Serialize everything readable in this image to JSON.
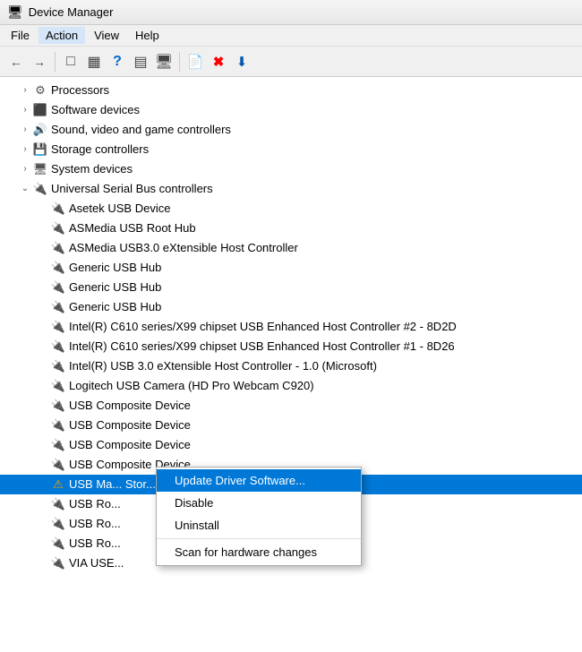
{
  "window": {
    "title": "Device Manager",
    "titleIcon": "🖥"
  },
  "menuBar": {
    "items": [
      {
        "label": "File",
        "id": "file"
      },
      {
        "label": "Action",
        "id": "action",
        "active": true
      },
      {
        "label": "View",
        "id": "view"
      },
      {
        "label": "Help",
        "id": "help"
      }
    ]
  },
  "toolbar": {
    "buttons": [
      {
        "id": "back",
        "icon": "←",
        "disabled": false
      },
      {
        "id": "forward",
        "icon": "→",
        "disabled": false
      },
      {
        "id": "up",
        "icon": "⬆",
        "disabled": false
      },
      {
        "id": "show-hidden",
        "icon": "▦",
        "disabled": false
      },
      {
        "id": "refresh",
        "icon": "↻",
        "disabled": false
      },
      {
        "separator": true
      },
      {
        "id": "properties",
        "icon": "📋",
        "disabled": false
      },
      {
        "id": "remove",
        "icon": "✖",
        "color": "red",
        "disabled": false
      },
      {
        "id": "update",
        "icon": "⬇",
        "disabled": false
      }
    ]
  },
  "tree": {
    "items": [
      {
        "id": "processors",
        "label": "Processors",
        "indent": 1,
        "expandable": true,
        "expanded": false,
        "icon": "chip"
      },
      {
        "id": "software-devices",
        "label": "Software devices",
        "indent": 1,
        "expandable": true,
        "expanded": false,
        "icon": "chip"
      },
      {
        "id": "sound",
        "label": "Sound, video and game controllers",
        "indent": 1,
        "expandable": true,
        "expanded": false,
        "icon": "sound"
      },
      {
        "id": "storage",
        "label": "Storage controllers",
        "indent": 1,
        "expandable": true,
        "expanded": false,
        "icon": "storage"
      },
      {
        "id": "system",
        "label": "System devices",
        "indent": 1,
        "expandable": true,
        "expanded": false,
        "icon": "system"
      },
      {
        "id": "usb-controllers",
        "label": "Universal Serial Bus controllers",
        "indent": 1,
        "expandable": true,
        "expanded": true,
        "icon": "usb"
      },
      {
        "id": "asetek",
        "label": "Asetek USB Device",
        "indent": 2,
        "expandable": false,
        "icon": "usb"
      },
      {
        "id": "asmedia-hub",
        "label": "ASMedia USB Root Hub",
        "indent": 2,
        "expandable": false,
        "icon": "usb"
      },
      {
        "id": "asmedia-3",
        "label": "ASMedia USB3.0 eXtensible Host Controller",
        "indent": 2,
        "expandable": false,
        "icon": "usb"
      },
      {
        "id": "generic-hub-1",
        "label": "Generic USB Hub",
        "indent": 2,
        "expandable": false,
        "icon": "usb"
      },
      {
        "id": "generic-hub-2",
        "label": "Generic USB Hub",
        "indent": 2,
        "expandable": false,
        "icon": "usb"
      },
      {
        "id": "generic-hub-3",
        "label": "Generic USB Hub",
        "indent": 2,
        "expandable": false,
        "icon": "usb"
      },
      {
        "id": "intel-c610-2",
        "label": "Intel(R) C610 series/X99 chipset USB Enhanced Host Controller #2 - 8D2D",
        "indent": 2,
        "expandable": false,
        "icon": "usb"
      },
      {
        "id": "intel-c610-1",
        "label": "Intel(R) C610 series/X99 chipset USB Enhanced Host Controller #1 - 8D26",
        "indent": 2,
        "expandable": false,
        "icon": "usb"
      },
      {
        "id": "intel-usb3",
        "label": "Intel(R) USB 3.0 eXtensible Host Controller - 1.0 (Microsoft)",
        "indent": 2,
        "expandable": false,
        "icon": "usb"
      },
      {
        "id": "logitech-cam",
        "label": "Logitech USB Camera (HD Pro Webcam C920)",
        "indent": 2,
        "expandable": false,
        "icon": "usb"
      },
      {
        "id": "usb-composite-1",
        "label": "USB Composite Device",
        "indent": 2,
        "expandable": false,
        "icon": "usb"
      },
      {
        "id": "usb-composite-2",
        "label": "USB Composite Device",
        "indent": 2,
        "expandable": false,
        "icon": "usb"
      },
      {
        "id": "usb-composite-3",
        "label": "USB Composite Device",
        "indent": 2,
        "expandable": false,
        "icon": "usb"
      },
      {
        "id": "usb-composite-4",
        "label": "USB Composite Device",
        "indent": 2,
        "expandable": false,
        "icon": "usb"
      },
      {
        "id": "usb-mass-storage",
        "label": "USB Ma... Stor... Devic...",
        "indent": 2,
        "expandable": false,
        "icon": "warning",
        "selected": true
      },
      {
        "id": "usb-root-1",
        "label": "USB Ro...",
        "indent": 2,
        "expandable": false,
        "icon": "usb"
      },
      {
        "id": "usb-root-2",
        "label": "USB Ro...",
        "indent": 2,
        "expandable": false,
        "icon": "usb"
      },
      {
        "id": "usb-root-3",
        "label": "USB Ro...",
        "indent": 2,
        "expandable": false,
        "icon": "usb"
      },
      {
        "id": "via-usb",
        "label": "VIA USE...",
        "indent": 2,
        "expandable": false,
        "icon": "usb"
      }
    ]
  },
  "contextMenu": {
    "items": [
      {
        "id": "update-driver",
        "label": "Update Driver Software...",
        "active": true
      },
      {
        "id": "disable",
        "label": "Disable"
      },
      {
        "id": "uninstall",
        "label": "Uninstall"
      },
      {
        "separator": true
      },
      {
        "id": "scan",
        "label": "Scan for hardware changes"
      }
    ]
  }
}
